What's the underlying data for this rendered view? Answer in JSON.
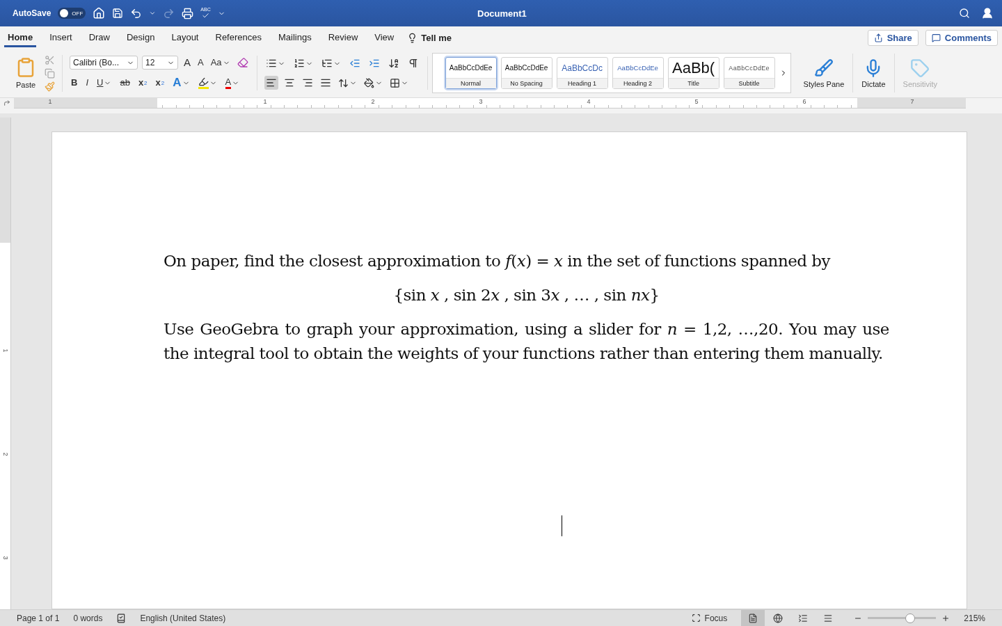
{
  "title_bar": {
    "autosave_label": "AutoSave",
    "autosave_on": false,
    "toggle_text": "OFF",
    "spell_label": "ABC",
    "title": "Document1"
  },
  "tabs": [
    {
      "label": "Home",
      "selected": true
    },
    {
      "label": "Insert",
      "selected": false
    },
    {
      "label": "Draw",
      "selected": false
    },
    {
      "label": "Design",
      "selected": false
    },
    {
      "label": "Layout",
      "selected": false
    },
    {
      "label": "References",
      "selected": false
    },
    {
      "label": "Mailings",
      "selected": false
    },
    {
      "label": "Review",
      "selected": false
    },
    {
      "label": "View",
      "selected": false
    }
  ],
  "tell_me": "Tell me",
  "share": "Share",
  "comments": "Comments",
  "clipboard": {
    "paste": "Paste"
  },
  "font": {
    "name": "Calibri (Bo...",
    "size": "12",
    "grow": "A",
    "shrink": "A",
    "change_case": "Aa",
    "bold": "B",
    "italic": "I",
    "underline": "U",
    "strike": "ab",
    "subscript": "x",
    "subscript_mark": "2",
    "superscript": "x",
    "superscript_mark": "2",
    "effects": "A",
    "color_letter": "A"
  },
  "alignment": [
    {
      "kind": "left",
      "selected": true
    },
    {
      "kind": "center",
      "selected": false
    },
    {
      "kind": "right",
      "selected": false
    },
    {
      "kind": "justify",
      "selected": false
    }
  ],
  "styles": [
    {
      "kind": "normal",
      "preview": "AaBbCcDdEe",
      "name": "Normal",
      "selected": true
    },
    {
      "kind": "plain",
      "preview": "AaBbCcDdEe",
      "name": "No Spacing",
      "selected": false
    },
    {
      "kind": "heading1",
      "preview": "AaBbCcDc",
      "name": "Heading 1",
      "selected": false
    },
    {
      "kind": "heading2",
      "preview": "AaBbCcDdEe",
      "name": "Heading 2",
      "selected": false
    },
    {
      "kind": "title",
      "preview": "AaBb(",
      "name": "Title",
      "selected": false
    },
    {
      "kind": "subtitle",
      "preview": "AaBbCcDdEe",
      "name": "Subtitle",
      "selected": false
    }
  ],
  "styles_pane": "Styles Pane",
  "dictate": "Dictate",
  "sensitivity": {
    "label": "Sensitivity",
    "disabled": true
  },
  "ruler": [
    "1",
    "1",
    "2",
    "3",
    "4",
    "5",
    "6",
    "7"
  ],
  "vertical_ruler": [
    "1",
    "2",
    "3"
  ],
  "document": {
    "paragraphs": [
      {
        "kind": "body",
        "text": "On paper, find the closest approximation to *f*(*x*) = *x* in the set of functions spanned by"
      },
      {
        "kind": "centered",
        "segments": [
          {
            "text": "{sin ",
            "italic": false
          },
          {
            "text": "x",
            "italic": true
          },
          {
            "text": " , sin 2",
            "italic": false
          },
          {
            "text": "x",
            "italic": true
          },
          {
            "text": " , sin 3",
            "italic": false
          },
          {
            "text": "x",
            "italic": true
          },
          {
            "text": " , … , sin ",
            "italic": false
          },
          {
            "text": "nx",
            "italic": true
          },
          {
            "text": "}",
            "italic": false
          }
        ]
      },
      {
        "kind": "justified",
        "text": "Use GeoGebra to graph your approximation, using a slider for *n* = 1,2, …,20. You may use the integral tool to obtain the weights of your functions rather than entering them manually."
      }
    ]
  },
  "status_bar": {
    "page": "Page 1 of 1",
    "words": "0 words",
    "language": "English (United States)",
    "focus": "Focus",
    "views": [
      {
        "kind": "print",
        "selected": true
      },
      {
        "kind": "web",
        "selected": false
      },
      {
        "kind": "outline",
        "selected": false
      },
      {
        "kind": "draft",
        "selected": false
      }
    ],
    "zoom": {
      "level": 0.62
    },
    "zoom_text": "215%"
  }
}
